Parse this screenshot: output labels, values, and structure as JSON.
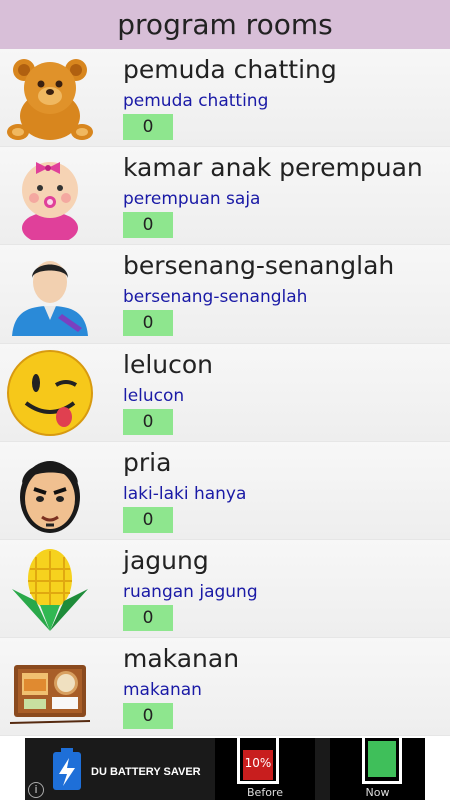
{
  "header": {
    "title": "program rooms"
  },
  "rooms": [
    {
      "title": "pemuda chatting",
      "subtitle": "pemuda chatting",
      "count": "0",
      "icon": "teddy-bear-icon"
    },
    {
      "title": "kamar anak perempuan",
      "subtitle": "perempuan saja",
      "count": "0",
      "icon": "baby-girl-icon"
    },
    {
      "title": "bersenang-senanglah",
      "subtitle": "bersenang-senanglah",
      "count": "0",
      "icon": "user-silhouette-icon"
    },
    {
      "title": "lelucon",
      "subtitle": "lelucon",
      "count": "0",
      "icon": "winking-smiley-icon"
    },
    {
      "title": "pria",
      "subtitle": "laki-laki hanya",
      "count": "0",
      "icon": "man-face-icon"
    },
    {
      "title": "jagung",
      "subtitle": "ruangan jagung",
      "count": "0",
      "icon": "corn-icon"
    },
    {
      "title": "makanan",
      "subtitle": "makanan",
      "count": "0",
      "icon": "food-tray-icon"
    }
  ],
  "ad": {
    "brand": "DU BATTERY SAVER",
    "before_label": "Before",
    "before_value": "10%",
    "now_label": "Now",
    "info": "i"
  },
  "colors": {
    "header_bg": "#d8bfd8",
    "subtitle": "#1a1aa6",
    "count_badge": "#8ee68e"
  }
}
